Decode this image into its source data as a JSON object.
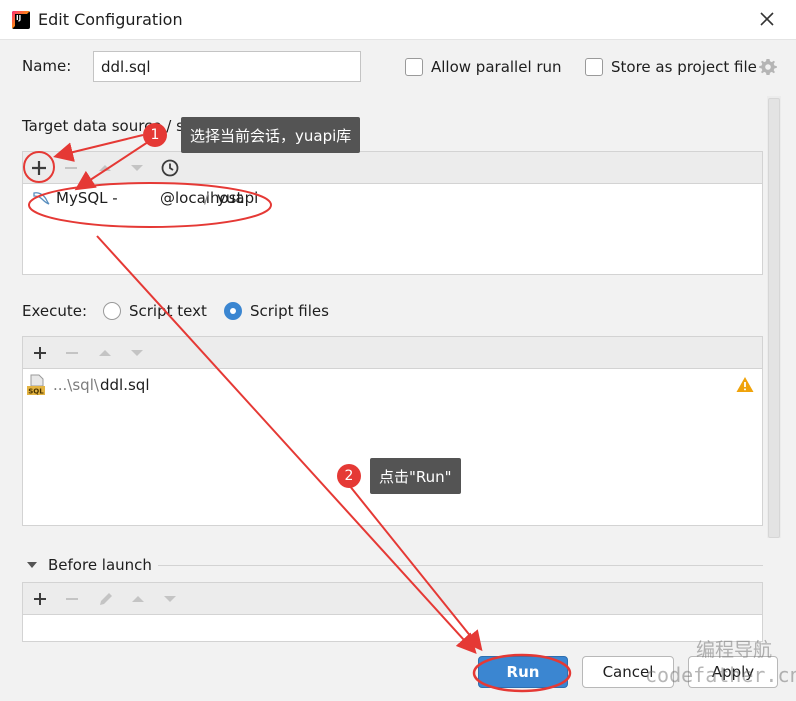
{
  "window": {
    "title": "Edit Configuration"
  },
  "name_field": {
    "label": "Name:",
    "value": "ddl.sql"
  },
  "options": {
    "allow_parallel": "Allow parallel run",
    "store_project": "Store as project file"
  },
  "target": {
    "label": "Target data source / schema:",
    "datasource": {
      "name": "MySQL - ",
      "host": "@localhost",
      "separator": " / ",
      "schema": "yuapi"
    }
  },
  "execute": {
    "label": "Execute:",
    "options": [
      "Script text",
      "Script files"
    ],
    "selected": "Script files",
    "file_prefix": "...\\sql\\",
    "file_name": "ddl.sql"
  },
  "before_launch": {
    "label": "Before launch"
  },
  "buttons": {
    "run": "Run",
    "cancel": "Cancel",
    "apply": "Apply"
  },
  "annotations": {
    "step1": {
      "number": "1",
      "text": "选择当前会话，yuapi库"
    },
    "step2": {
      "number": "2",
      "text": "点击\"Run\""
    }
  },
  "watermark": {
    "line1": "编程导航",
    "line2": "codefather.cn"
  },
  "colors": {
    "accent": "#3b86d1",
    "annotation": "#e53935",
    "warning": "#f0a30a"
  }
}
